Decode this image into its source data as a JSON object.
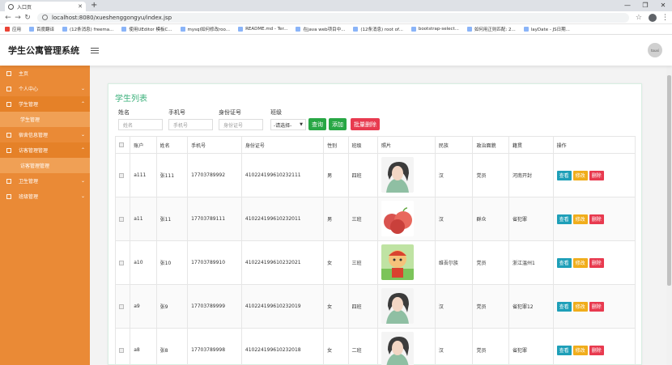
{
  "browser": {
    "tab_title": "入口页",
    "url": "localhost:8080/xueshenggongyu/index.jsp",
    "bookmarks": [
      "应用",
      "百度翻译",
      "(12条消息) freema...",
      "使用UEditor 模板C...",
      "mysql如何修改roo...",
      "README.md - Ter...",
      "在java web项目中...",
      "(12条消息) root of...",
      "bootstrap-select...",
      "如何用正则匹配: 2...",
      "layDate - JS日期..."
    ]
  },
  "app": {
    "title": "学生公寓管理系统",
    "avatar_text": "touxi"
  },
  "sidebar": {
    "items": [
      {
        "label": "主页",
        "has_arrow": false
      },
      {
        "label": "个人中心",
        "has_arrow": true
      },
      {
        "label": "学生管理",
        "has_arrow": true,
        "expanded": true
      },
      {
        "label": "学生管理",
        "sub": true
      },
      {
        "label": "宿舍信息管理",
        "has_arrow": true
      },
      {
        "label": "访客管理管理",
        "has_arrow": true,
        "expanded": true
      },
      {
        "label": "访客管理管理",
        "sub": true
      },
      {
        "label": "卫生管理",
        "has_arrow": true
      },
      {
        "label": "班级管理",
        "has_arrow": true
      }
    ]
  },
  "list": {
    "title": "学生列表",
    "filters": {
      "name_label": "姓名",
      "name_placeholder": "姓名",
      "phone_label": "手机号",
      "phone_placeholder": "手机号",
      "id_label": "身份证号",
      "id_placeholder": "身份证号",
      "class_label": "班级",
      "class_selected": "-请选择-"
    },
    "buttons": {
      "search": "查询",
      "add": "添加",
      "batch_delete": "批量删除"
    },
    "columns": [
      "账户",
      "姓名",
      "手机号",
      "身份证号",
      "性别",
      "班级",
      "照片",
      "民族",
      "政治面貌",
      "籍贯",
      "操作"
    ],
    "row_buttons": {
      "view": "查看",
      "edit": "修改",
      "delete": "删除"
    },
    "rows": [
      {
        "account": "a111",
        "name": "张111",
        "phone": "17703789992",
        "idcard": "410224199610232111",
        "gender": "男",
        "class": "四班",
        "photo": "girl",
        "ethnic": "汉",
        "political": "党员",
        "hometown": "河南开封"
      },
      {
        "account": "a11",
        "name": "张11",
        "phone": "17703789111",
        "idcard": "410224199610232011",
        "gender": "男",
        "class": "三班",
        "photo": "apples",
        "ethnic": "汉",
        "political": "群众",
        "hometown": "省犯罪"
      },
      {
        "account": "a10",
        "name": "张10",
        "phone": "17703789910",
        "idcard": "410224199610232021",
        "gender": "女",
        "class": "三班",
        "photo": "cartoon",
        "ethnic": "维吾尔族",
        "political": "党员",
        "hometown": "浙江温州1"
      },
      {
        "account": "a9",
        "name": "张9",
        "phone": "17703789999",
        "idcard": "410224199610232019",
        "gender": "女",
        "class": "四班",
        "photo": "girl",
        "ethnic": "汉",
        "political": "党员",
        "hometown": "省犯罪12"
      },
      {
        "account": "a8",
        "name": "张8",
        "phone": "17703789998",
        "idcard": "410224199610232018",
        "gender": "女",
        "class": "二班",
        "photo": "girl",
        "ethnic": "汉",
        "political": "党员",
        "hometown": "省犯罪"
      }
    ]
  },
  "colors": {
    "sidebar": "#ea8a36",
    "title_green": "#3ab07a",
    "btn_search": "#28a745",
    "btn_add": "#28a745",
    "btn_batch_delete": "#e83a4f",
    "btn_view": "#1e9fb8",
    "btn_edit": "#f0ad1b",
    "btn_delete": "#e83a4f"
  }
}
